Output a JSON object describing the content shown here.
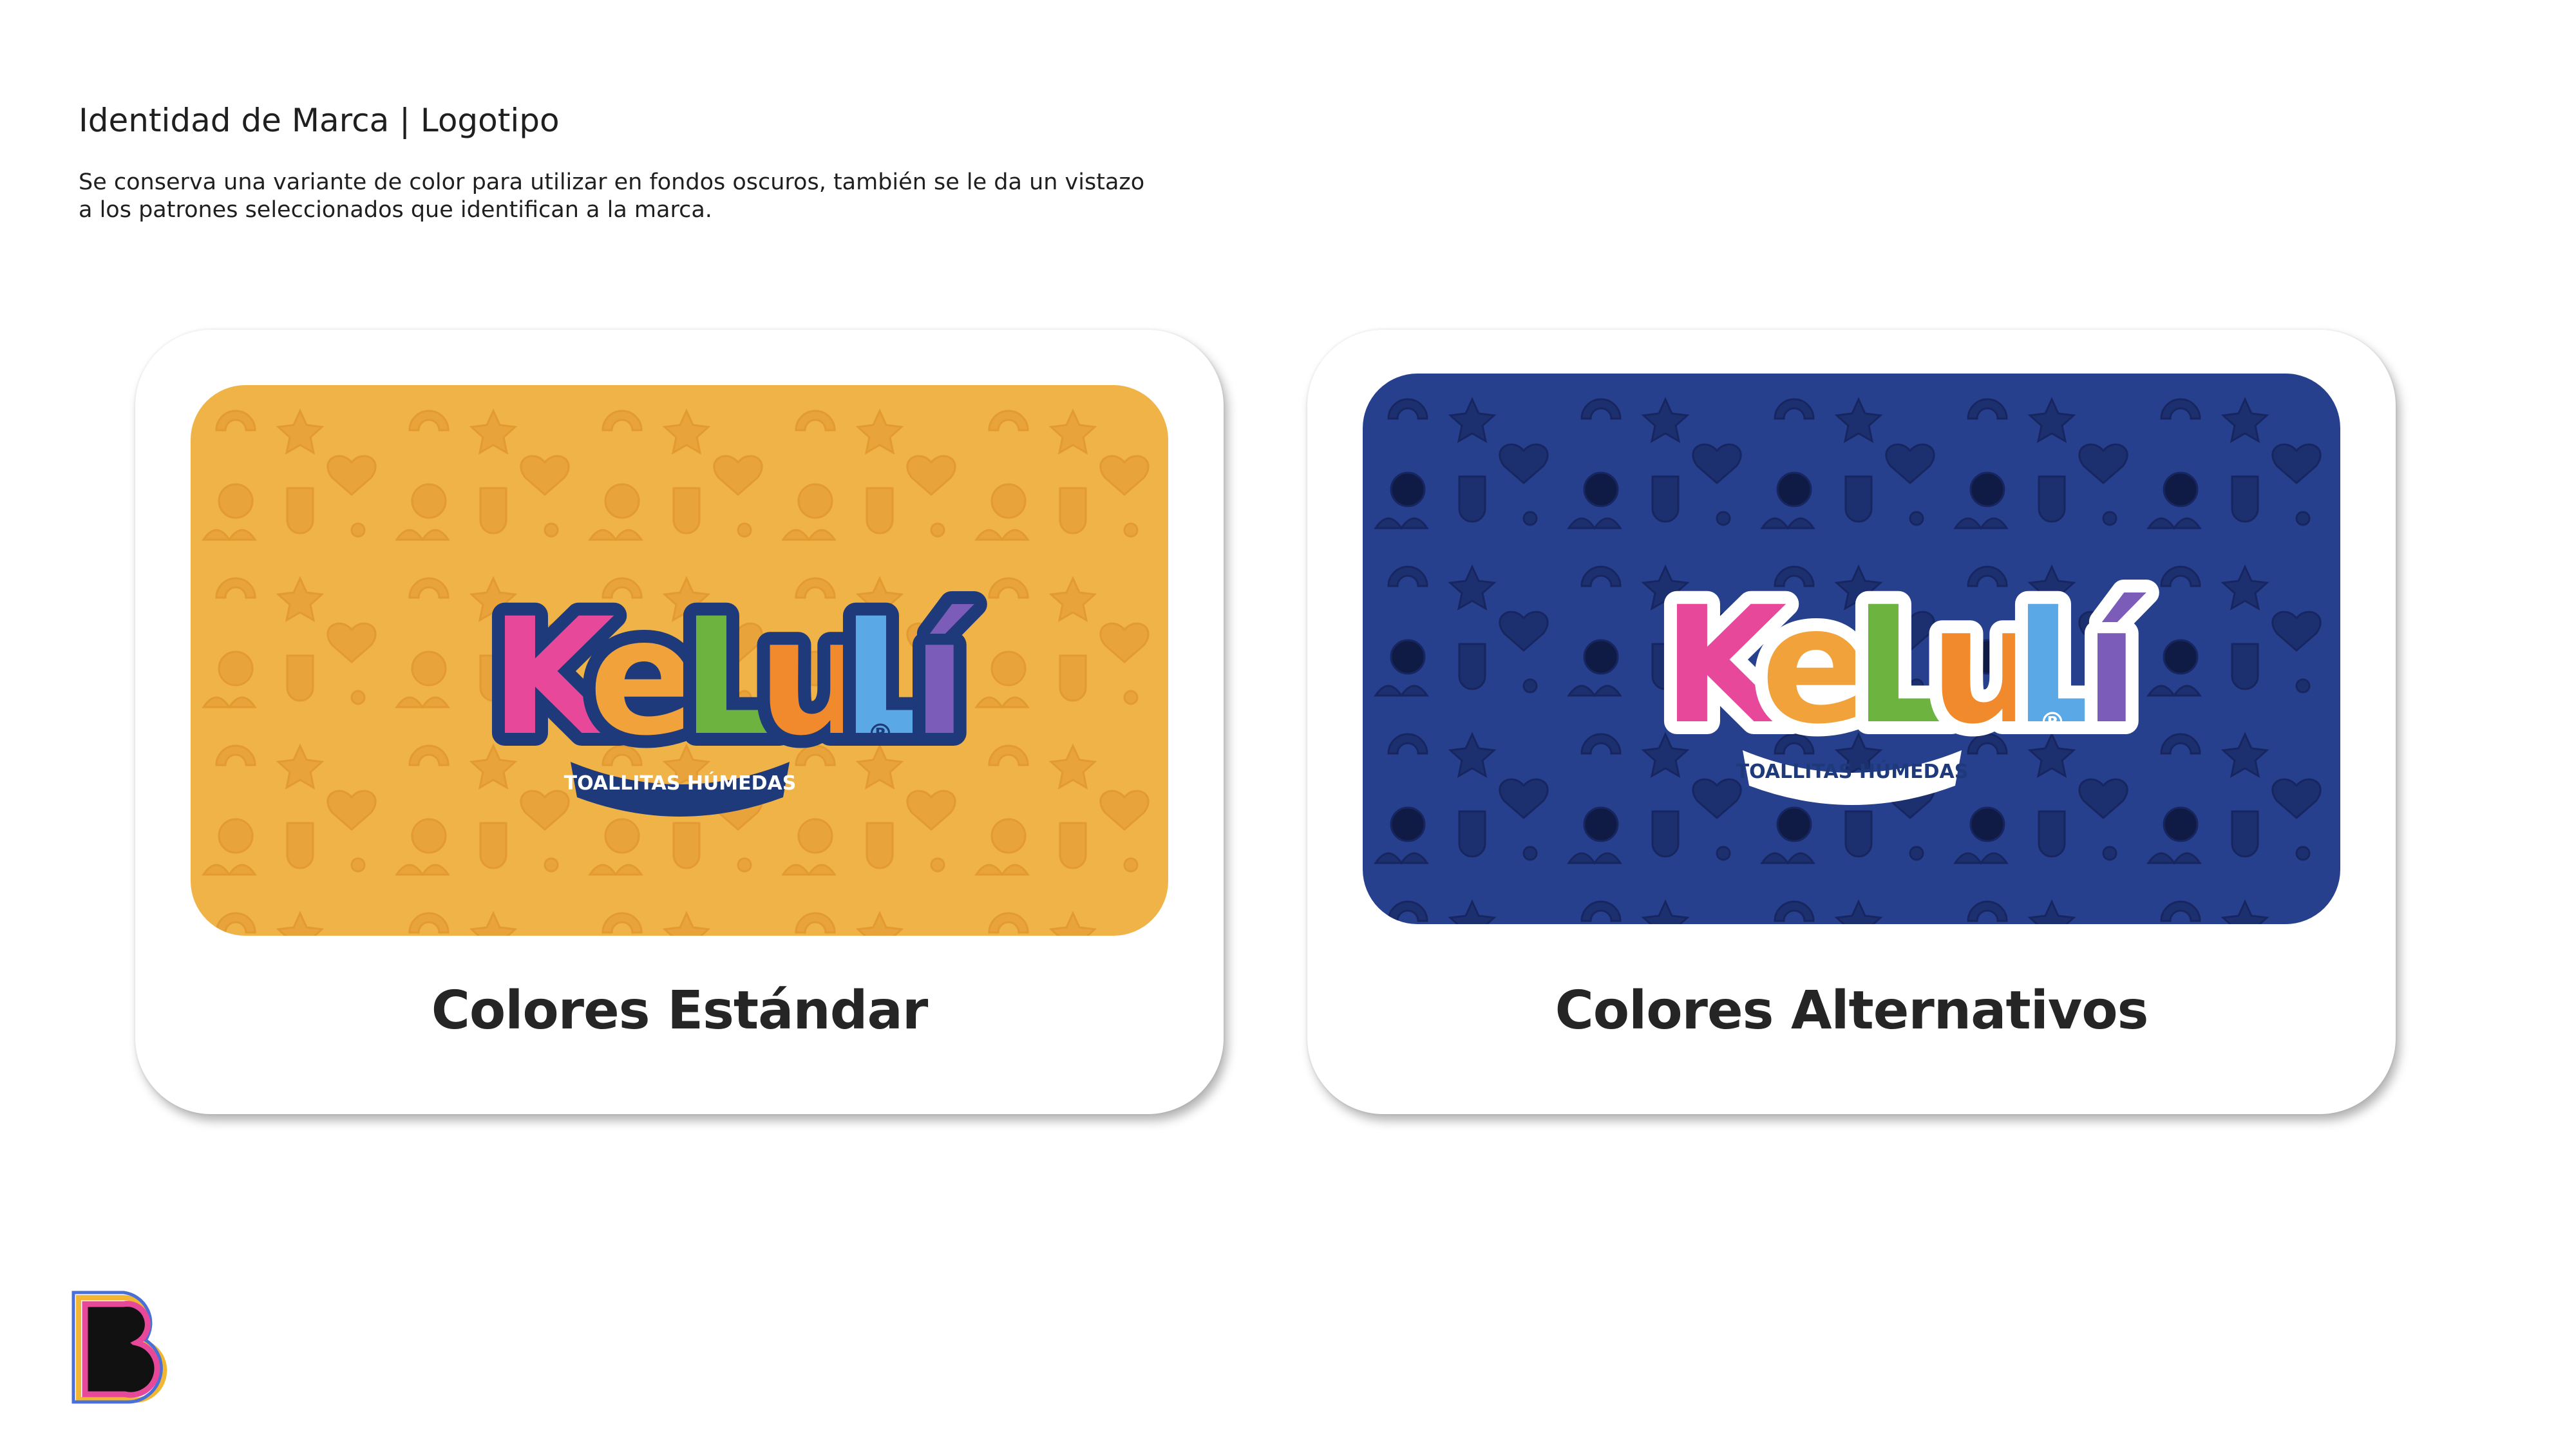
{
  "header": {
    "title": "Identidad de Marca | Logotipo",
    "description_lines": [
      "Se conserva una variante de color para utilizar en fondos oscuros, también se le da un vistazo",
      "a los patrones seleccionados que identifican a la marca."
    ]
  },
  "cards": [
    {
      "label": "Colores Estándar",
      "background_color": "#EFB347",
      "pattern_color": "#E8A33A",
      "logo_outline": "#1F3A7A"
    },
    {
      "label": "Colores Alternativos",
      "background_color": "#26408E",
      "pattern_color": "#1C2F6E",
      "logo_outline": "#FFFFFF"
    }
  ],
  "logo": {
    "wordmark": "KeLuLí",
    "tagline": "TOALLITAS HÚMEDAS",
    "registered": "®",
    "letter_colors": [
      "#E8489A",
      "#F2A23A",
      "#6DB33F",
      "#F08A2C",
      "#5AA9E6",
      "#7B5CB8"
    ]
  },
  "footer": {
    "brand_letter": "B",
    "brand_colors": [
      "#E8489A",
      "#F2B632",
      "#4A6FD6",
      "#111111"
    ]
  }
}
